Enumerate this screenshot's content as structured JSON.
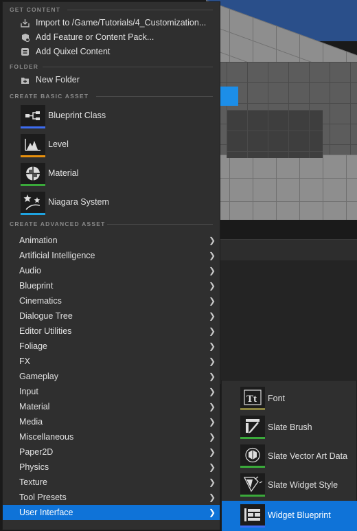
{
  "menu": {
    "get_content": {
      "title": "GET CONTENT",
      "items": [
        {
          "label": "Import to /Game/Tutorials/4_Customization...",
          "icon": "import-icon"
        },
        {
          "label": "Add Feature or Content Pack...",
          "icon": "feature-pack-icon"
        },
        {
          "label": "Add Quixel Content",
          "icon": "quixel-icon"
        }
      ]
    },
    "folder": {
      "title": "FOLDER",
      "items": [
        {
          "label": "New Folder",
          "icon": "new-folder-icon"
        }
      ]
    },
    "basic": {
      "title": "CREATE BASIC ASSET",
      "items": [
        {
          "label": "Blueprint Class",
          "icon": "blueprint-class-icon",
          "color": "#3d6cf0"
        },
        {
          "label": "Level",
          "icon": "level-icon",
          "color": "#e8900d"
        },
        {
          "label": "Material",
          "icon": "material-icon",
          "color": "#3aa93a"
        },
        {
          "label": "Niagara System",
          "icon": "niagara-system-icon",
          "color": "#1fa3e0"
        }
      ]
    },
    "advanced": {
      "title": "CREATE ADVANCED ASSET",
      "items": [
        {
          "label": "Animation"
        },
        {
          "label": "Artificial Intelligence"
        },
        {
          "label": "Audio"
        },
        {
          "label": "Blueprint"
        },
        {
          "label": "Cinematics"
        },
        {
          "label": "Dialogue Tree"
        },
        {
          "label": "Editor Utilities"
        },
        {
          "label": "Foliage"
        },
        {
          "label": "FX"
        },
        {
          "label": "Gameplay"
        },
        {
          "label": "Input"
        },
        {
          "label": "Material"
        },
        {
          "label": "Media"
        },
        {
          "label": "Miscellaneous"
        },
        {
          "label": "Paper2D"
        },
        {
          "label": "Physics"
        },
        {
          "label": "Texture"
        },
        {
          "label": "Tool Presets"
        },
        {
          "label": "User Interface",
          "selected": true
        }
      ]
    }
  },
  "submenu": {
    "items": [
      {
        "label": "Font",
        "icon": "font-icon",
        "color": "#8a8440"
      },
      {
        "label": "Slate Brush",
        "icon": "slate-brush-icon",
        "color": "#3aa93a"
      },
      {
        "label": "Slate Vector Art Data",
        "icon": "slate-vector-art-icon",
        "color": "#3aa93a"
      },
      {
        "label": "Slate Widget Style",
        "icon": "slate-widget-style-icon",
        "color": "#3aa93a"
      },
      {
        "label": "Widget Blueprint",
        "icon": "widget-blueprint-icon",
        "color": "#3d6cf0",
        "selected": true
      }
    ]
  }
}
